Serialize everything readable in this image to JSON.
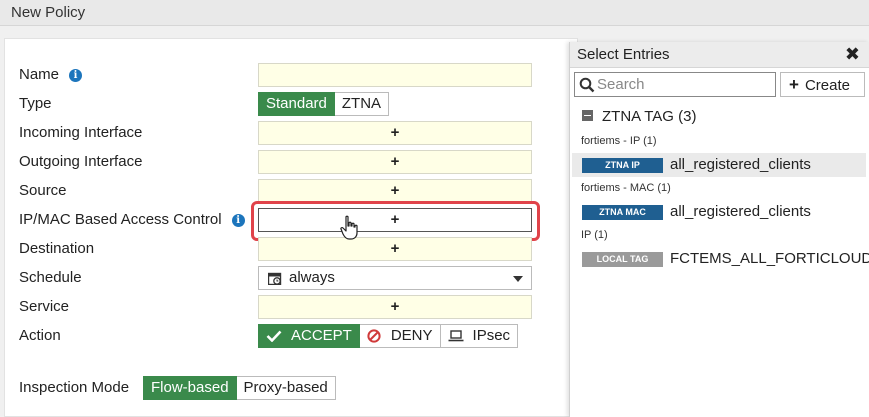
{
  "page": {
    "title": "New Policy"
  },
  "form": {
    "labels": {
      "name": "Name",
      "type": "Type",
      "incoming": "Incoming Interface",
      "outgoing": "Outgoing Interface",
      "source": "Source",
      "ipmac": "IP/MAC Based Access Control",
      "destination": "Destination",
      "schedule": "Schedule",
      "service": "Service",
      "action": "Action",
      "inspection": "Inspection Mode"
    },
    "info_glyph": "i",
    "name_value": "",
    "add_glyph": "+",
    "type_options": [
      "Standard",
      "ZTNA"
    ],
    "type_selected": "Standard",
    "schedule_value": "always",
    "action_options": {
      "accept": "ACCEPT",
      "deny": "DENY",
      "ipsec": "IPsec"
    },
    "action_selected": "ACCEPT",
    "inspection_options": [
      "Flow-based",
      "Proxy-based"
    ],
    "inspection_selected": "Flow-based",
    "highlight_color": "#e0434a",
    "accent_color": "#3a8a4b"
  },
  "side": {
    "title": "Select Entries",
    "close_glyph": "✖",
    "search_placeholder": "Search",
    "create_label": "Create",
    "create_glyph": "+",
    "group_label": "ZTNA TAG (3)",
    "sections": [
      {
        "label": "fortiems - IP (1)",
        "tag": "ZTNA IP",
        "tag_color": "#1f5f91",
        "name": "all_registered_clients",
        "selected": true
      },
      {
        "label": "fortiems - MAC (1)",
        "tag": "ZTNA MAC",
        "tag_color": "#1f5f91",
        "name": "all_registered_clients",
        "selected": false
      },
      {
        "label": "IP (1)",
        "tag": "LOCAL TAG",
        "tag_color": "#9a9a9a",
        "name": "FCTEMS_ALL_FORTICLOUD_S",
        "selected": false
      }
    ]
  }
}
